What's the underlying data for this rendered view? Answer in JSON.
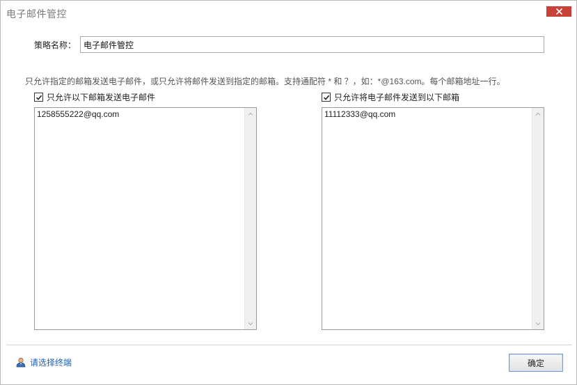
{
  "window": {
    "title": "电子邮件管控"
  },
  "form": {
    "name_label": "策略名称：",
    "name_value": "电子邮件管控",
    "hint": "只允许指定的邮箱发送电子邮件，或只允许将邮件发送到指定的邮箱。支持通配符 * 和 ？，如：*@163.com。每个邮箱地址一行。"
  },
  "left_panel": {
    "checkbox_label": "只允许以下邮箱发送电子邮件",
    "checked": true,
    "text": "1258555222@qq.com"
  },
  "right_panel": {
    "checkbox_label": "只允许将电子邮件发送到以下邮箱",
    "checked": true,
    "text": "11112333@qq.com"
  },
  "footer": {
    "select_terminal_label": "请选择终端",
    "ok_label": "确定"
  },
  "colors": {
    "close_button": "#c9423a",
    "link": "#1d5fb8"
  }
}
